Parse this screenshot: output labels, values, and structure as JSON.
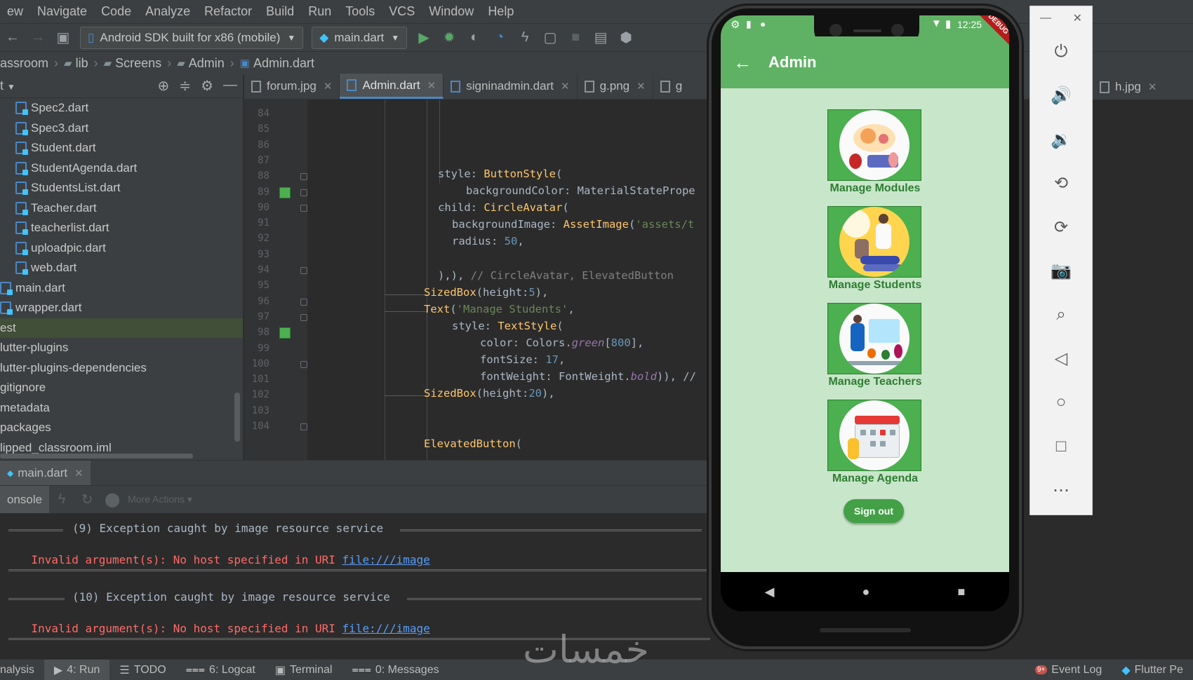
{
  "menu": [
    "ew",
    "Navigate",
    "Code",
    "Analyze",
    "Refactor",
    "Build",
    "Run",
    "Tools",
    "VCS",
    "Window",
    "Help"
  ],
  "toolbar": {
    "device": "Android SDK built for x86 (mobile)",
    "config": "main.dart"
  },
  "breadcrumb": [
    "assroom",
    "lib",
    "Screens",
    "Admin",
    "Admin.dart"
  ],
  "project": {
    "header": "t",
    "items": [
      {
        "label": "Spec2.dart",
        "type": "dart",
        "indent": 1
      },
      {
        "label": "Spec3.dart",
        "type": "dart",
        "indent": 1
      },
      {
        "label": "Student.dart",
        "type": "dart",
        "indent": 1
      },
      {
        "label": "StudentAgenda.dart",
        "type": "dart",
        "indent": 1
      },
      {
        "label": "StudentsList.dart",
        "type": "dart",
        "indent": 1
      },
      {
        "label": "Teacher.dart",
        "type": "dart",
        "indent": 1
      },
      {
        "label": "teacherlist.dart",
        "type": "dart",
        "indent": 1
      },
      {
        "label": "uploadpic.dart",
        "type": "dart",
        "indent": 1
      },
      {
        "label": "web.dart",
        "type": "dart",
        "indent": 1
      },
      {
        "label": "main.dart",
        "type": "dart",
        "indent": 0
      },
      {
        "label": "wrapper.dart",
        "type": "dart",
        "indent": 0
      },
      {
        "label": "est",
        "type": "folder",
        "indent": 0,
        "selected": true
      },
      {
        "label": "lutter-plugins",
        "type": "file",
        "indent": 0
      },
      {
        "label": "lutter-plugins-dependencies",
        "type": "file",
        "indent": 0
      },
      {
        "label": "gitignore",
        "type": "file",
        "indent": 0
      },
      {
        "label": "metadata",
        "type": "file",
        "indent": 0
      },
      {
        "label": "packages",
        "type": "file",
        "indent": 0
      },
      {
        "label": "lipped_classroom.iml",
        "type": "file",
        "indent": 0
      }
    ]
  },
  "tabs": [
    {
      "label": "forum.jpg",
      "active": false
    },
    {
      "label": "Admin.dart",
      "active": true
    },
    {
      "label": "signinadmin.dart",
      "active": false
    },
    {
      "label": "g.png",
      "active": false
    },
    {
      "label": "g",
      "active": false
    },
    {
      "label": "h.jpg",
      "active": false
    }
  ],
  "editor": {
    "line_numbers": [
      "84",
      "85",
      "86",
      "87",
      "88",
      "89",
      "90",
      "91",
      "92",
      "93",
      "94",
      "95",
      "96",
      "97",
      "98",
      "99",
      "100",
      "101",
      "102",
      "103",
      "104"
    ]
  },
  "run": {
    "tab": "main.dart",
    "console_tab": "onsole",
    "more_actions": "More Actions",
    "exceptions": [
      {
        "header": "(9) Exception caught by image resource service",
        "error": "Invalid argument(s): No host specified in URI ",
        "link": "file:///image"
      },
      {
        "header": "(10) Exception caught by image resource service",
        "error": "Invalid argument(s): No host specified in URI ",
        "link": "file:///image"
      }
    ]
  },
  "statusbar": {
    "items": [
      "nalysis",
      "4: Run",
      "TODO",
      "6: Logcat",
      "Terminal",
      "0: Messages"
    ],
    "right": [
      "Event Log",
      "Flutter Pe"
    ],
    "event_badge": "9+"
  },
  "watermark": "خمسات",
  "phone": {
    "time": "12:25",
    "appbar_title": "Admin",
    "debug_banner": "DEBUG",
    "items": [
      {
        "label": "Manage Modules",
        "image": "modules-illustration"
      },
      {
        "label": "Manage Students",
        "image": "students-illustration"
      },
      {
        "label": "Manage Teachers",
        "image": "teachers-illustration"
      },
      {
        "label": "Manage Agenda",
        "image": "agenda-illustration"
      }
    ],
    "signout_label": "Sign out"
  },
  "colors": {
    "accent": "#4caf50",
    "app_bg": "#c8e6c9",
    "label": "#2e7d32",
    "ide_bg": "#2b2b2b",
    "error": "#ff6b68"
  }
}
